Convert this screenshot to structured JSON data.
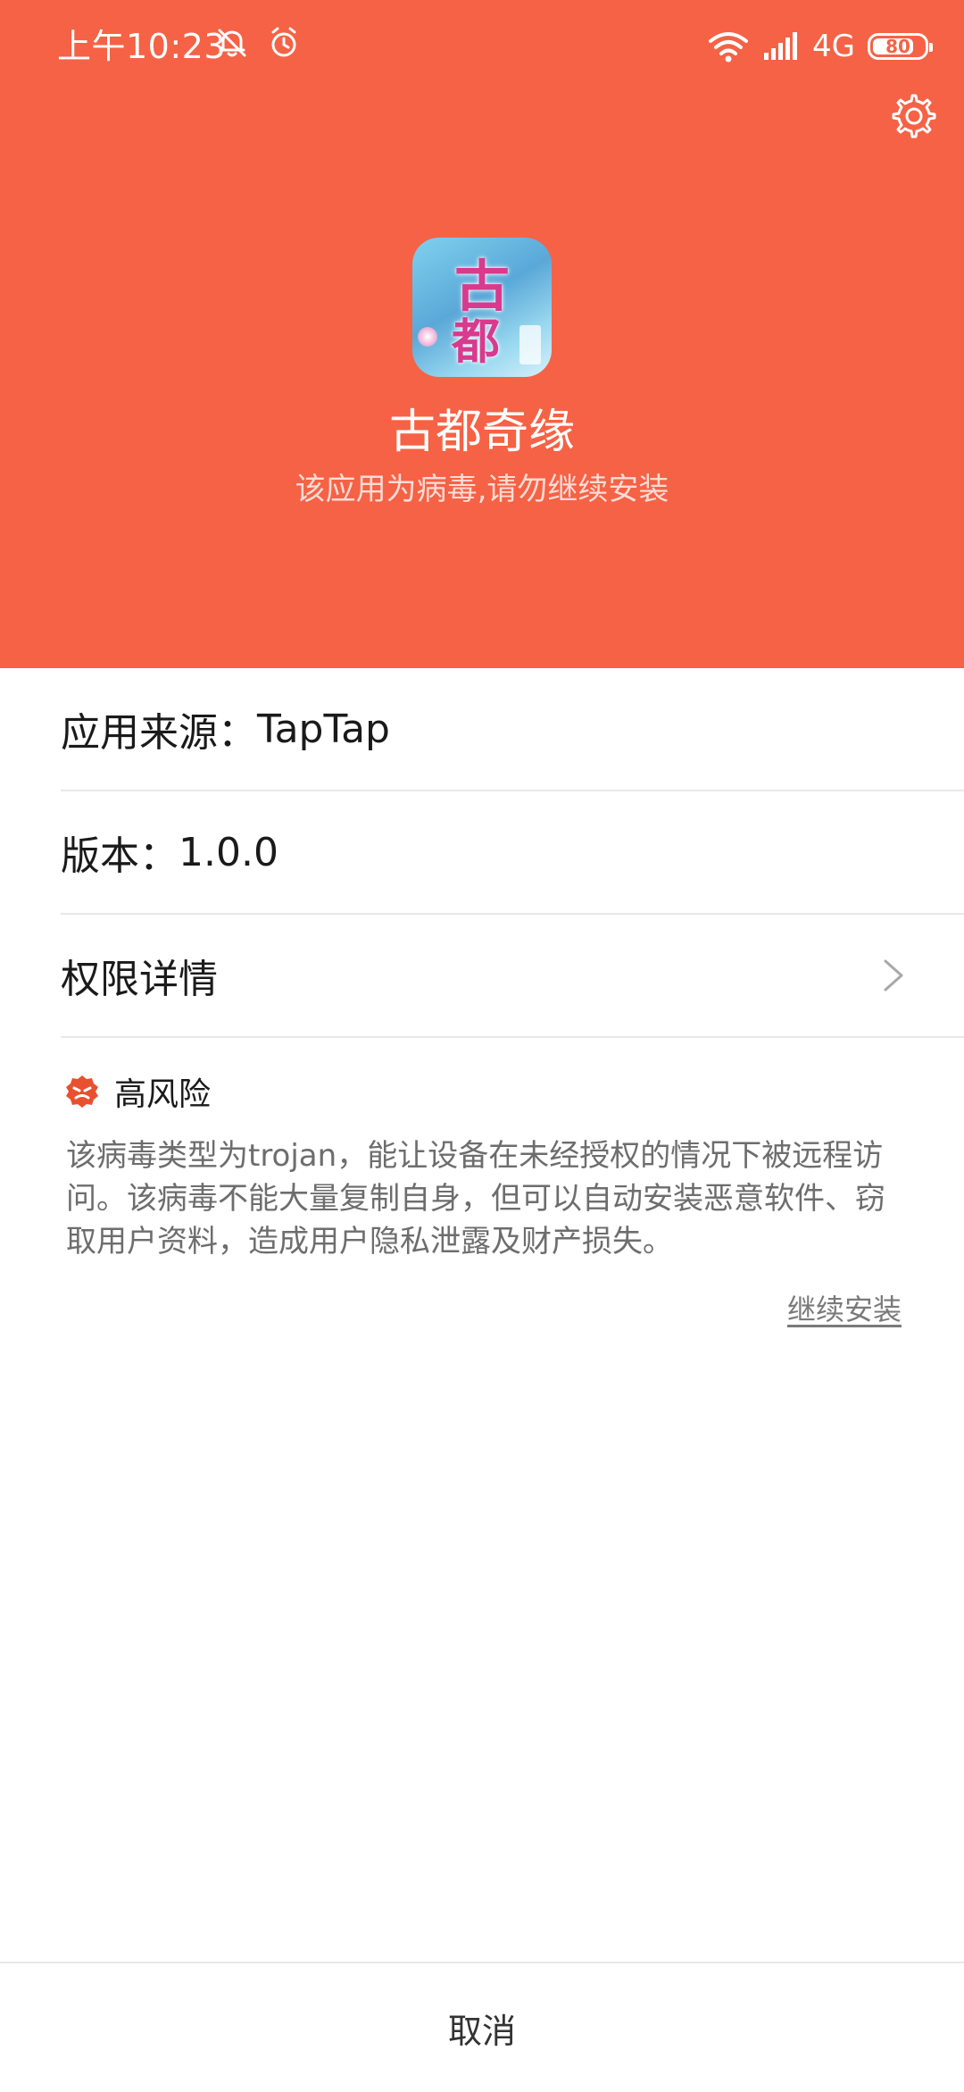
{
  "status_bar": {
    "time": "上午10:23",
    "network": "4G",
    "battery": "80",
    "battery_level": 0.8,
    "icons": [
      "mute-bell-icon",
      "alarm-icon",
      "wifi-icon",
      "signal-icon",
      "battery-icon"
    ]
  },
  "header": {
    "background_color": "#f56245",
    "settings_icon": "gear-icon",
    "app_icon_glyphs": [
      "古",
      "都"
    ],
    "app_name": "古都奇缘",
    "warning": "该应用为病毒,请勿继续安装"
  },
  "info": {
    "source": {
      "label": "应用来源：",
      "value": "TapTap"
    },
    "version": {
      "label": "版本：",
      "value": "1.0.0"
    },
    "permissions": {
      "label": "权限详情"
    }
  },
  "risk": {
    "icon": "risk-badge-icon",
    "level": "高风险",
    "description": "该病毒类型为trojan，能让设备在未经授权的情况下被远程访问。该病毒不能大量复制自身，但可以自动安装恶意软件、窃取用户资料，造成用户隐私泄露及财产损失。",
    "continue_label": "继续安装"
  },
  "footer": {
    "cancel_label": "取消"
  }
}
